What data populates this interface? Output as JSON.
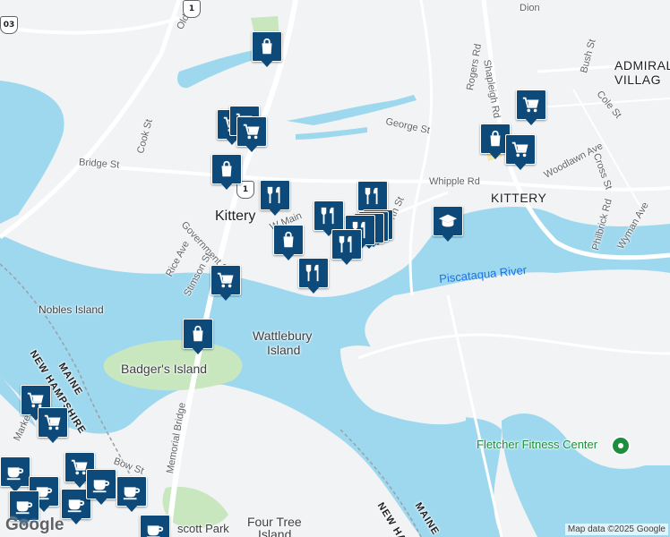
{
  "colors": {
    "water": "#9ed8ef",
    "land": "#f1f3f4",
    "park": "#c9e7bf",
    "road": "#ffffff",
    "marker": "#0d4a7a"
  },
  "labels": {
    "old_post_rd": "Old Post Rd",
    "cook_st": "Cook St",
    "bridge_st": "Bridge St",
    "kittery_west": "Kittery",
    "kittery_east": "KITTERY",
    "admiralty_1": "ADMIRAL",
    "admiralty_2": "VILLAG",
    "rogers_rd": "Rogers Rd",
    "shapleigh_rd": "Shapleigh Rd",
    "bush_st": "Bush St",
    "cole_st": "Cole St",
    "cross_st": "Cross St",
    "woodlawn_ave": "Woodlawn Ave",
    "philbrick_rd": "Philbrick Rd",
    "wyman_ave": "Wyman Ave",
    "whipple_rd": "Whipple Rd",
    "george_st": "George St",
    "north_st": "orth St",
    "main_st": "W      Main",
    "dion": "Dion",
    "government_st": "Government St",
    "rice_ave": "Rice Ave",
    "stimson_st": "Stimson St",
    "piscataqua": "Piscataqua River",
    "nobles_island": "Nobles Island",
    "wattlebury_1": "Wattlebury",
    "wattlebury_2": "Island",
    "badgers_island": "Badger's Island",
    "maine_1": "MAINE",
    "new_hampshire_1": "NEW HAMPSHIRE",
    "maine_2": "MAINE",
    "new_hampshire_2": "NEW HA",
    "memorial_bridge": "Memorial Bridge",
    "market_st": "Market St",
    "bow_st": "Bow St",
    "prescott_park": "scott Park",
    "four_tree_1": "Four Tree",
    "four_tree_2": "Island",
    "fletcher": "Fletcher Fitness Center"
  },
  "route_shields": [
    "1",
    "1",
    "03"
  ],
  "markers": [
    {
      "type": "shopping-bag"
    },
    {
      "type": "shopping-cart"
    },
    {
      "type": "shopping-cart"
    },
    {
      "type": "shopping-cart"
    },
    {
      "type": "shopping-bag"
    },
    {
      "type": "restaurant"
    },
    {
      "type": "restaurant"
    },
    {
      "type": "restaurant"
    },
    {
      "type": "restaurant"
    },
    {
      "type": "restaurant"
    },
    {
      "type": "shopping-bag"
    },
    {
      "type": "restaurant"
    },
    {
      "type": "shopping-cart"
    },
    {
      "type": "shopping-bag"
    },
    {
      "type": "school"
    },
    {
      "type": "shopping-cart"
    },
    {
      "type": "shopping-bag"
    },
    {
      "type": "shopping-cart"
    },
    {
      "type": "shopping-cart"
    },
    {
      "type": "shopping-cart"
    },
    {
      "type": "shopping-cart"
    },
    {
      "type": "coffee"
    },
    {
      "type": "coffee"
    },
    {
      "type": "coffee"
    },
    {
      "type": "coffee"
    },
    {
      "type": "coffee"
    },
    {
      "type": "coffee"
    },
    {
      "type": "coffee"
    }
  ],
  "logo": "Google",
  "attribution": "Map data ©2025 Google"
}
